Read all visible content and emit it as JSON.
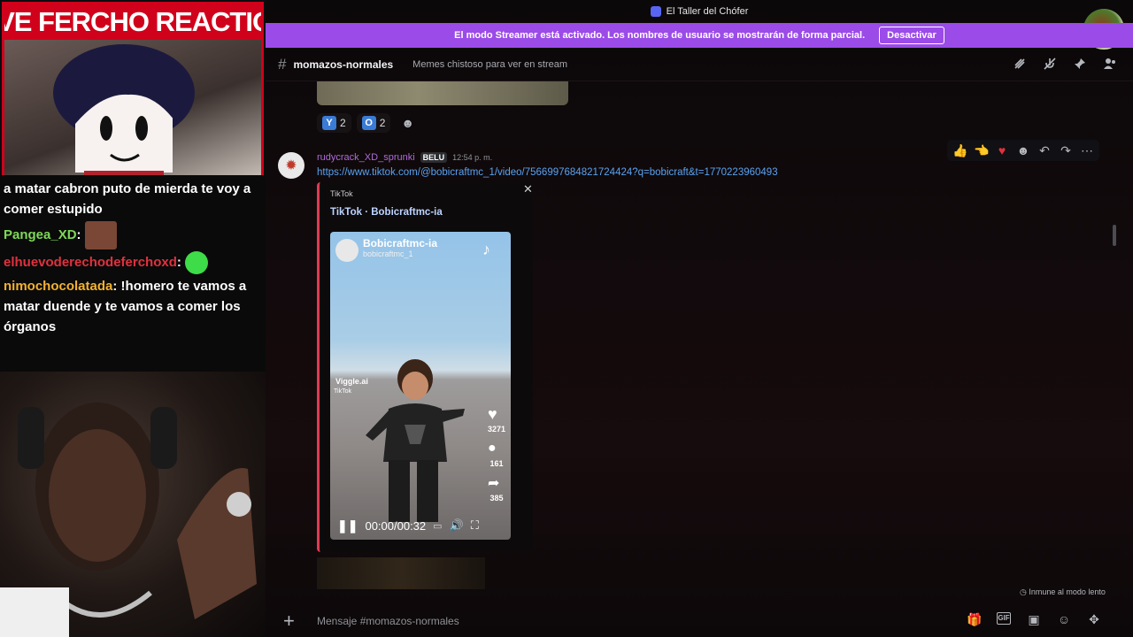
{
  "overlay": {
    "banner": "LIVE FERCHO REACTION",
    "chat": [
      {
        "user": "",
        "text": "a matar cabron puto de mierda te voy a comer estupido",
        "color": "#ffffff"
      },
      {
        "user": "Pangea_XD",
        "text": "",
        "color": "#7ed957"
      },
      {
        "user": "elhuevoderechodeferchoxd",
        "text": "",
        "color": "#e0313e"
      },
      {
        "user": "nimochocolatada",
        "text": "!homero te vamos a matar duende y te vamos a comer los órganos",
        "color": "#f2b233"
      }
    ]
  },
  "window": {
    "title": "El Taller del Chófer"
  },
  "streamer_bar": {
    "message": "El modo Streamer está activado. Los nombres de usuario se mostrarán de forma parcial.",
    "button": "Desactivar"
  },
  "channel": {
    "name": "momazos-normales",
    "topic": "Memes chistoso para ver en stream",
    "header_icons": [
      "threads-icon",
      "mute-icon",
      "pin-icon",
      "members-icon"
    ]
  },
  "reactions": [
    {
      "emoji": "Y",
      "count": "2"
    },
    {
      "emoji": "O",
      "count": "2"
    }
  ],
  "message": {
    "user": "rudycrack_XD_sprunki",
    "tag": "BELU",
    "time": "12:54 p. m.",
    "link": "https://www.tiktok.com/@bobicraftmc_1/video/7566997684821724424?q=bobicraft&t=1770223960493"
  },
  "embed": {
    "provider": "TikTok",
    "title": "TikTok · Bobicraftmc-ia",
    "video": {
      "account_name": "Bobicraftmc-ia",
      "handle": "bobicraftmc_1",
      "watermark": "Viggle.ai",
      "watermark_sub": "TikTok",
      "likes": "3271",
      "comments": "161",
      "shares": "385",
      "time": "00:00/00:32"
    }
  },
  "slowmode": "Inmune al modo lento",
  "composer": {
    "placeholder": "Mensaje #momazos-normales"
  },
  "colors": {
    "streamer_bar": "#9b4be8",
    "banner": "#d0021b",
    "link": "#5aa2f0",
    "embed_accent": "#e13a52"
  }
}
